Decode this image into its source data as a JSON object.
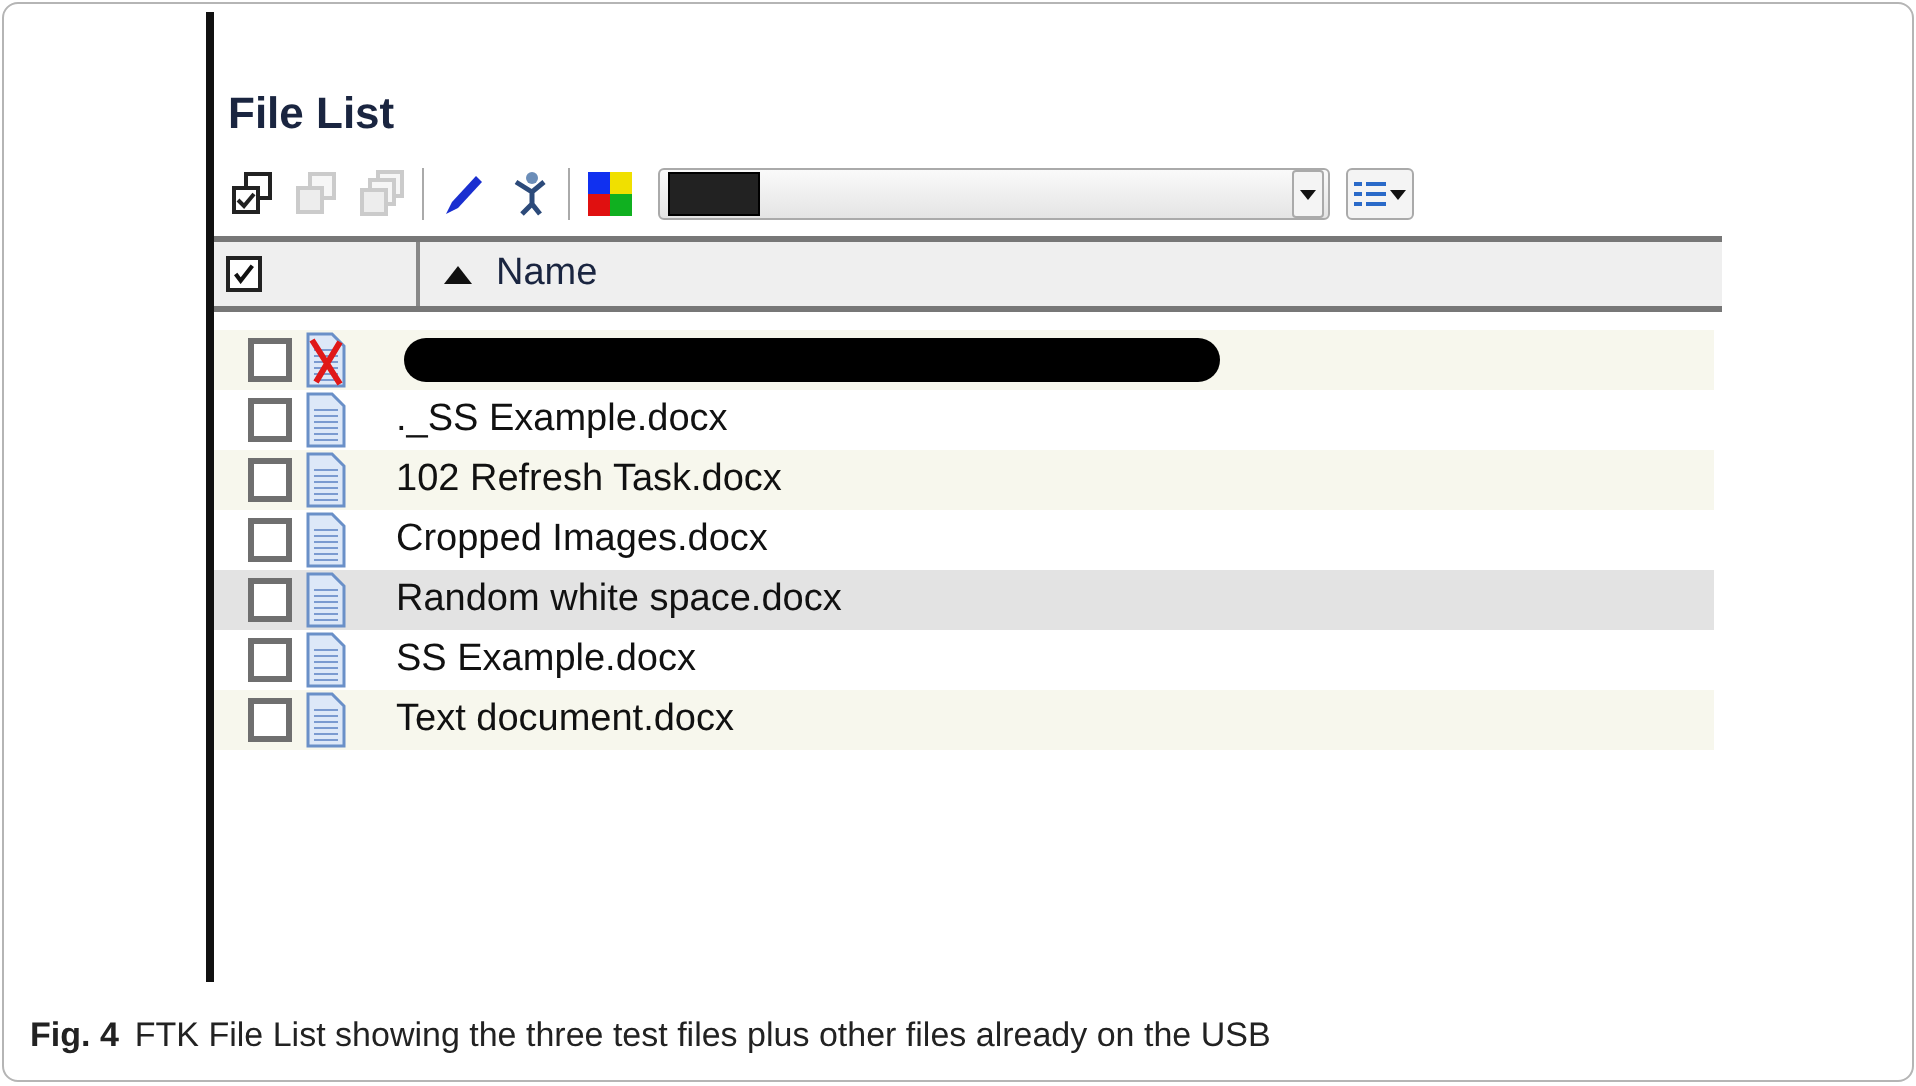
{
  "panel": {
    "title": "File List"
  },
  "toolbar": {
    "buttons": [
      {
        "kind": "check-all",
        "disabled": false
      },
      {
        "kind": "copy",
        "disabled": true
      },
      {
        "kind": "copy-multi",
        "disabled": true
      },
      {
        "kind": "pen",
        "disabled": false
      },
      {
        "kind": "figure",
        "disabled": false
      },
      {
        "kind": "palette",
        "disabled": false
      }
    ]
  },
  "table": {
    "header": {
      "checked": true,
      "label": "Name"
    },
    "rows": [
      {
        "kind": "deleted",
        "redacted": true,
        "checked": false,
        "selected": false
      },
      {
        "kind": "document",
        "name": "._SS Example.docx",
        "checked": false,
        "selected": false
      },
      {
        "kind": "document",
        "name": "102 Refresh Task.docx",
        "checked": false,
        "selected": false
      },
      {
        "kind": "document",
        "name": "Cropped Images.docx",
        "checked": false,
        "selected": false
      },
      {
        "kind": "document",
        "name": "Random white space.docx",
        "checked": false,
        "selected": true
      },
      {
        "kind": "document",
        "name": "SS Example.docx",
        "checked": false,
        "selected": false
      },
      {
        "kind": "document",
        "name": "Text document.docx",
        "checked": false,
        "selected": false
      }
    ]
  },
  "caption": {
    "label": "Fig. 4",
    "text": "FTK File List showing the three test files plus other files already on the USB"
  }
}
